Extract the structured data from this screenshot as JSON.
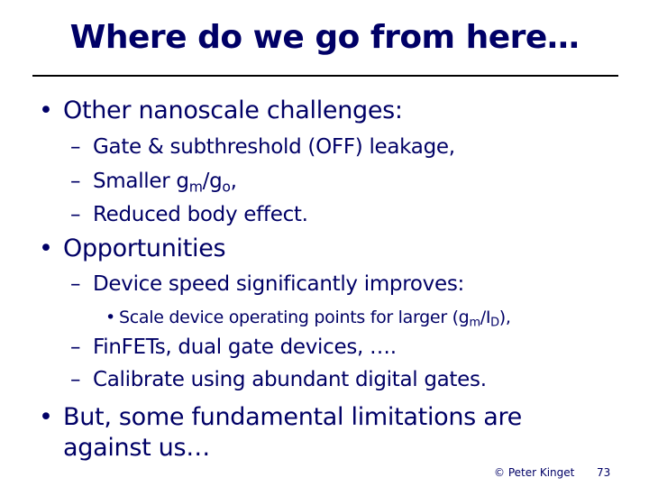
{
  "title": "Where do we go from here…",
  "bullets": {
    "b1": "Other nanoscale challenges:",
    "b1_sub1": "Gate & subthreshold (OFF) leakage,",
    "b1_sub2_pre": "Smaller g",
    "b1_sub2_sub_a": "m",
    "b1_sub2_mid": "/g",
    "b1_sub2_sub_b": "o",
    "b1_sub2_post": ",",
    "b1_sub3": "Reduced body effect.",
    "b2": "Opportunities",
    "b2_sub1": "Device speed significantly improves:",
    "b2_sub1_item_pre": "Scale device operating points for larger (g",
    "b2_sub1_item_sub_a": "m",
    "b2_sub1_item_mid": "/I",
    "b2_sub1_item_sub_b": "D",
    "b2_sub1_item_post": "),",
    "b2_sub2": "FinFETs, dual gate devices, ….",
    "b2_sub3": "Calibrate using abundant digital gates.",
    "b3_line1": "But, some fundamental limitations are",
    "b3_line2": "against us…"
  },
  "symbols": {
    "bullet": "•",
    "dash": "–"
  },
  "footer": {
    "copyright": "© Peter Kinget",
    "page_number": "73"
  }
}
